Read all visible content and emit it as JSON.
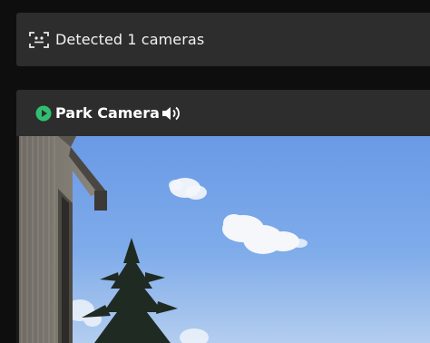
{
  "detection": {
    "icon": "face-detect-icon",
    "text": "Detected 1 cameras"
  },
  "camera": {
    "status_icon": "play-circle-icon",
    "status_color": "#2fbf71",
    "title": "Park Camera",
    "audio_icon": "speaker-icon"
  },
  "colors": {
    "panel": "#2d2d2d",
    "background": "#0e0e0e",
    "sky": "#6a9ae6"
  }
}
